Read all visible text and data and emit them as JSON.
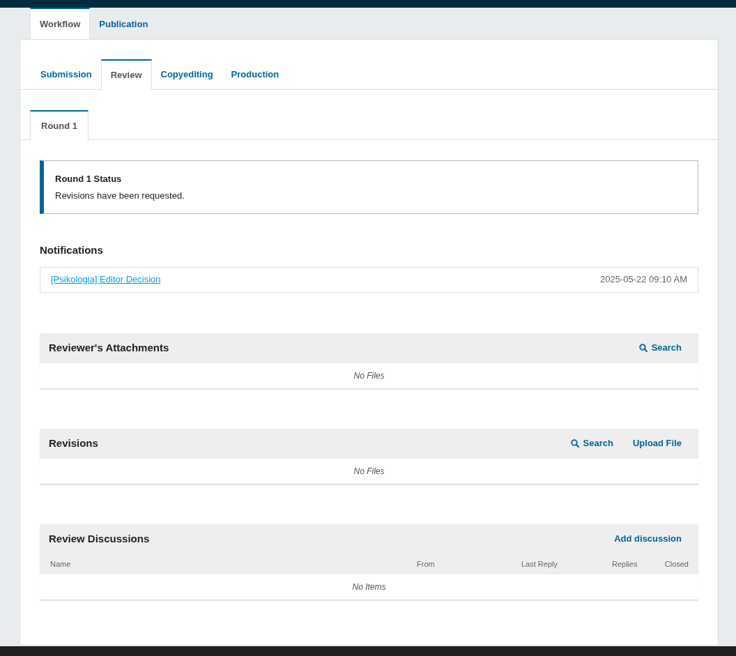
{
  "main_tabs": [
    {
      "label": "Workflow",
      "selected": true
    },
    {
      "label": "Publication",
      "selected": false
    }
  ],
  "stage_tabs": [
    {
      "label": "Submission",
      "selected": false
    },
    {
      "label": "Review",
      "selected": true
    },
    {
      "label": "Copyediting",
      "selected": false
    },
    {
      "label": "Production",
      "selected": false
    }
  ],
  "round_tabs": [
    {
      "label": "Round 1",
      "selected": true
    }
  ],
  "status": {
    "title": "Round 1 Status",
    "message": "Revisions have been requested."
  },
  "notifications": {
    "title": "Notifications",
    "items": [
      {
        "link": "[Psikologia] Editor Decision",
        "time": "2025-05-22 09:10 AM"
      }
    ]
  },
  "grids": [
    {
      "title": "Reviewer's Attachments",
      "actions": [
        {
          "label": "Search",
          "kind": "search"
        }
      ],
      "empty": "No Files"
    },
    {
      "title": "Revisions",
      "actions": [
        {
          "label": "Search",
          "kind": "search"
        },
        {
          "label": "Upload File",
          "kind": "plain"
        }
      ],
      "empty": "No Files"
    },
    {
      "title": "Review Discussions",
      "actions": [
        {
          "label": "Add discussion",
          "kind": "plain"
        }
      ],
      "columns": [
        "Name",
        "From",
        "Last Reply",
        "Replies",
        "Closed"
      ],
      "empty": "No Items"
    }
  ]
}
